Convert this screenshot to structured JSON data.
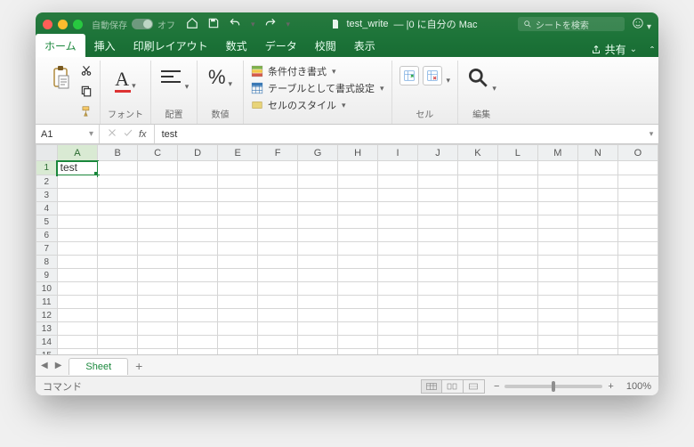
{
  "titlebar": {
    "autosave_label": "自動保存",
    "autosave_state": "オフ",
    "doc_name": "test_write",
    "title_suffix": " — |0 に自分の Mac",
    "search_placeholder": "シートを検索"
  },
  "tabs": {
    "items": [
      "ホーム",
      "挿入",
      "印刷レイアウト",
      "数式",
      "データ",
      "校閲",
      "表示"
    ],
    "active_index": 0,
    "share_label": "共有"
  },
  "ribbon": {
    "paste_label": "ペースト",
    "font_label": "フォント",
    "align_label": "配置",
    "number_label": "数値",
    "percent_glyph": "%",
    "cond_format": "条件付き書式",
    "as_table": "テーブルとして書式設定",
    "cell_styles": "セルのスタイル",
    "cells_label": "セル",
    "edit_label": "編集"
  },
  "formula": {
    "namebox": "A1",
    "fx_label": "fx",
    "value": "test"
  },
  "grid": {
    "columns": [
      "A",
      "B",
      "C",
      "D",
      "E",
      "F",
      "G",
      "H",
      "I",
      "J",
      "K",
      "L",
      "M",
      "N",
      "O"
    ],
    "rows": 17,
    "selected": {
      "row": 1,
      "col": 0
    },
    "cells": {
      "A1": "test"
    }
  },
  "sheets": {
    "active_name": "Sheet"
  },
  "status": {
    "left": "コマンド",
    "zoom": "100%",
    "minus": "−",
    "plus": "+"
  }
}
